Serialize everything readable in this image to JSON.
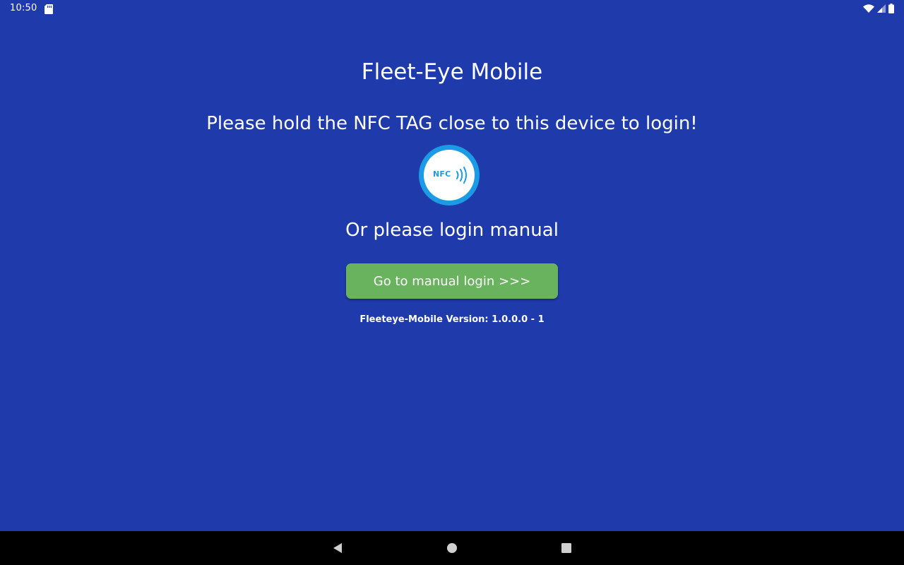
{
  "status_bar": {
    "time": "10:50",
    "icons": [
      "sd-card-icon",
      "wifi-icon",
      "cellular-signal-icon",
      "battery-icon"
    ]
  },
  "main": {
    "app_title": "Fleet-Eye Mobile",
    "nfc_instruction": "Please hold the NFC TAG close to this device to login!",
    "nfc_badge_text": "NFC",
    "manual_prompt": "Or please login manual",
    "manual_login_button": "Go to manual login >>>",
    "version": "Fleeteye-Mobile Version: 1.0.0.0 - 1"
  },
  "nav_bar": {
    "buttons": [
      "back-icon",
      "home-icon",
      "recents-icon"
    ]
  },
  "colors": {
    "background": "#1f3aab",
    "button_green": "#6ab35e",
    "nfc_blue": "#1b9be3",
    "nav_bar": "#000000"
  }
}
